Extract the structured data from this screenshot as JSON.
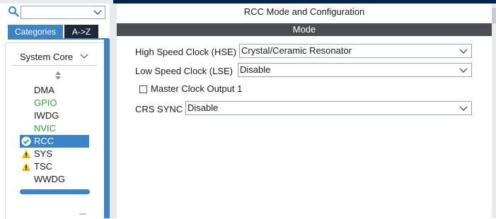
{
  "sidebar": {
    "search": {
      "value": ""
    },
    "tabs": [
      {
        "label": "Categories"
      },
      {
        "label": "A->Z"
      }
    ],
    "group": {
      "title": "System Core"
    },
    "items": [
      {
        "label": "DMA",
        "state": "normal"
      },
      {
        "label": "GPIO",
        "state": "configured"
      },
      {
        "label": "IWDG",
        "state": "normal"
      },
      {
        "label": "NVIC",
        "state": "configured"
      },
      {
        "label": "RCC",
        "state": "selected-ok"
      },
      {
        "label": "SYS",
        "state": "warning"
      },
      {
        "label": "TSC",
        "state": "warning"
      },
      {
        "label": "WWDG",
        "state": "normal"
      }
    ]
  },
  "main": {
    "title": "RCC Mode and Configuration",
    "section": "Mode",
    "hse": {
      "label": "High Speed Clock (HSE)",
      "value": "Crystal/Ceramic Resonator"
    },
    "lse": {
      "label": "Low Speed Clock (LSE)",
      "value": "Disable"
    },
    "mco": {
      "label": "Master Clock Output 1",
      "checked": false
    },
    "crs": {
      "label": "CRS SYNC",
      "value": "Disable"
    }
  },
  "colors": {
    "accent": "#3c84c8",
    "dark": "#03234b",
    "green": "#2faa3f",
    "warning": "#f2c200",
    "mode_bar": "#4a4d52"
  },
  "icons": [
    "search-icon",
    "chevron-down-icon",
    "sort-icon",
    "check-circle-icon",
    "warning-icon"
  ]
}
